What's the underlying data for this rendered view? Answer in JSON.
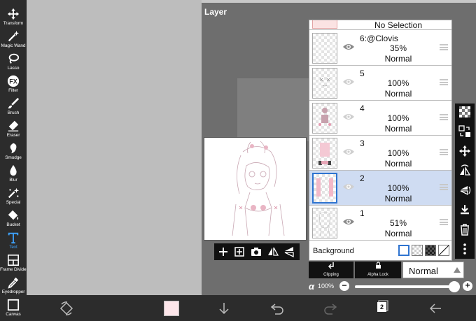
{
  "toolbar": {
    "tools": [
      {
        "label": "Transform",
        "icon": "move-arrows-icon"
      },
      {
        "label": "Magic Wand",
        "icon": "magic-wand-icon"
      },
      {
        "label": "Lasso",
        "icon": "lasso-icon"
      },
      {
        "label": "Filter",
        "icon": "fx-icon"
      },
      {
        "label": "Brush",
        "icon": "brush-icon"
      },
      {
        "label": "Eraser",
        "icon": "eraser-icon"
      },
      {
        "label": "Smudge",
        "icon": "smudge-icon"
      },
      {
        "label": "Blur",
        "icon": "blur-drop-icon"
      },
      {
        "label": "Special",
        "icon": "special-sparkle-icon"
      },
      {
        "label": "Bucket",
        "icon": "bucket-icon"
      },
      {
        "label": "Text",
        "icon": "text-t-icon"
      },
      {
        "label": "Frame Divider",
        "icon": "frame-divider-icon"
      },
      {
        "label": "Eyedropper",
        "icon": "eyedropper-icon"
      },
      {
        "label": "Canvas",
        "icon": "canvas-icon"
      }
    ],
    "active_tool": "Text",
    "active_color": "#3ea3ff"
  },
  "layer_panel": {
    "title": "Layer",
    "no_selection": "No Selection",
    "layers": [
      {
        "name": "6:@Clovis",
        "opacity": "35%",
        "blend": "Normal",
        "selected": false
      },
      {
        "name": "5",
        "opacity": "100%",
        "blend": "Normal",
        "selected": false
      },
      {
        "name": "4",
        "opacity": "100%",
        "blend": "Normal",
        "selected": false
      },
      {
        "name": "3",
        "opacity": "100%",
        "blend": "Normal",
        "selected": false
      },
      {
        "name": "2",
        "opacity": "100%",
        "blend": "Normal",
        "selected": true
      },
      {
        "name": "1",
        "opacity": "51%",
        "blend": "Normal",
        "selected": false
      }
    ],
    "background_label": "Background",
    "selected_color": "#cfdcf2"
  },
  "blend_controls": {
    "clipping_label": "Clipping",
    "alpha_lock_label": "Alpha Lock",
    "blend_mode": "Normal",
    "alpha_symbol": "α",
    "alpha_value": "100%",
    "alpha_fraction": 1.0
  },
  "bottom_bar": {
    "current_color": "#fde6ea",
    "layer_count": "2"
  }
}
